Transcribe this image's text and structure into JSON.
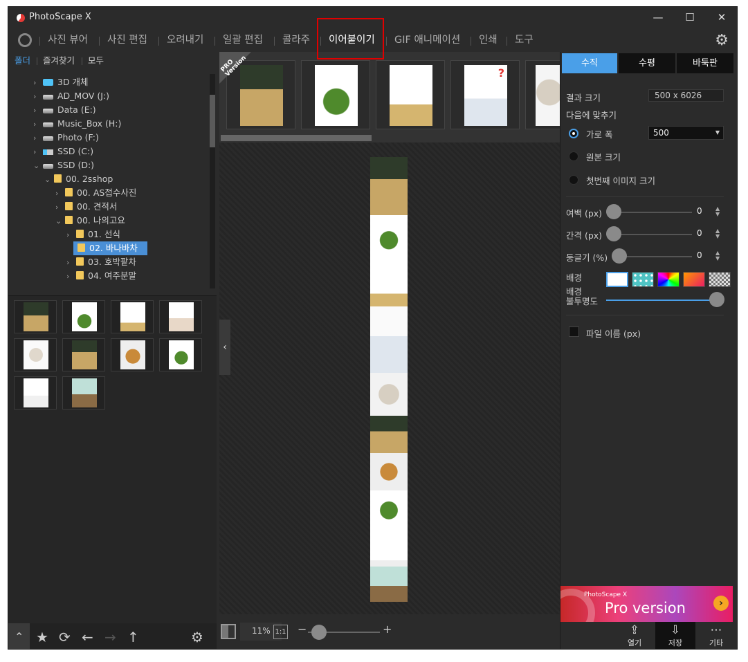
{
  "window": {
    "title": "PhotoScape X",
    "minimize": "—",
    "maximize": "☐",
    "close": "✕"
  },
  "menu": {
    "items": [
      "사진 뷰어",
      "사진 편집",
      "오려내기",
      "일괄 편집",
      "콜라주",
      "이어붙이기",
      "GIF 애니메이션",
      "인쇄",
      "도구"
    ],
    "active": "이어붙이기"
  },
  "left_tabs": [
    "폴더",
    "즐겨찾기",
    "모두"
  ],
  "tree": [
    {
      "label": "3D 개체",
      "indent": 0,
      "icon": "cube"
    },
    {
      "label": "AD_MOV (J:)",
      "indent": 0,
      "icon": "drive"
    },
    {
      "label": "Data (E:)",
      "indent": 0,
      "icon": "drive"
    },
    {
      "label": "Music_Box (H:)",
      "indent": 0,
      "icon": "drive"
    },
    {
      "label": "Photo (F:)",
      "indent": 0,
      "icon": "drive"
    },
    {
      "label": "SSD (C:)",
      "indent": 0,
      "icon": "ssd"
    },
    {
      "label": "SSD (D:)",
      "indent": 0,
      "icon": "drive",
      "open": true
    },
    {
      "label": "00. 2sshop",
      "indent": 1,
      "icon": "folder",
      "open": true
    },
    {
      "label": "00. AS접수사진",
      "indent": 2,
      "icon": "folder"
    },
    {
      "label": "00. 견적서",
      "indent": 2,
      "icon": "folder"
    },
    {
      "label": "00. 나의고요",
      "indent": 2,
      "icon": "folder",
      "open": true
    },
    {
      "label": "01. 선식",
      "indent": 3,
      "icon": "folder"
    },
    {
      "label": "02. 바나바차",
      "indent": 3,
      "icon": "folder",
      "selected": true,
      "nochev": true
    },
    {
      "label": "03. 호박팥차",
      "indent": 3,
      "icon": "folder"
    },
    {
      "label": "04. 여주분말",
      "indent": 3,
      "icon": "folder"
    }
  ],
  "zoom": {
    "percent": "11%",
    "one_to_one": "1:1",
    "minus": "−",
    "plus": "+"
  },
  "right_tabs": [
    "수직",
    "수평",
    "바둑판"
  ],
  "options": {
    "result_size_label": "결과 크기",
    "result_size_value": "500 x 6026",
    "fit_label": "다음에 맞추기",
    "fit_options": [
      "가로 폭",
      "원본 크기",
      "첫번째 이미지 크기"
    ],
    "fit_selected": "가로 폭",
    "width_value": "500",
    "margin_label": "여백 (px)",
    "margin_value": "0",
    "spacing_label": "간격 (px)",
    "spacing_value": "0",
    "round_label": "둥글기 (%)",
    "round_value": "0",
    "background_label": "배경",
    "opacity_label": "배경\n불투명도",
    "opacity_value": 1.0,
    "filename_label": "파일 이름 (px)"
  },
  "pro_banner": {
    "small": "PhotoScape X",
    "big": "Pro version"
  },
  "bottom_buttons": {
    "open": "열기",
    "save": "저장",
    "more": "기타"
  },
  "strip_badge": "PRO\nVersion"
}
